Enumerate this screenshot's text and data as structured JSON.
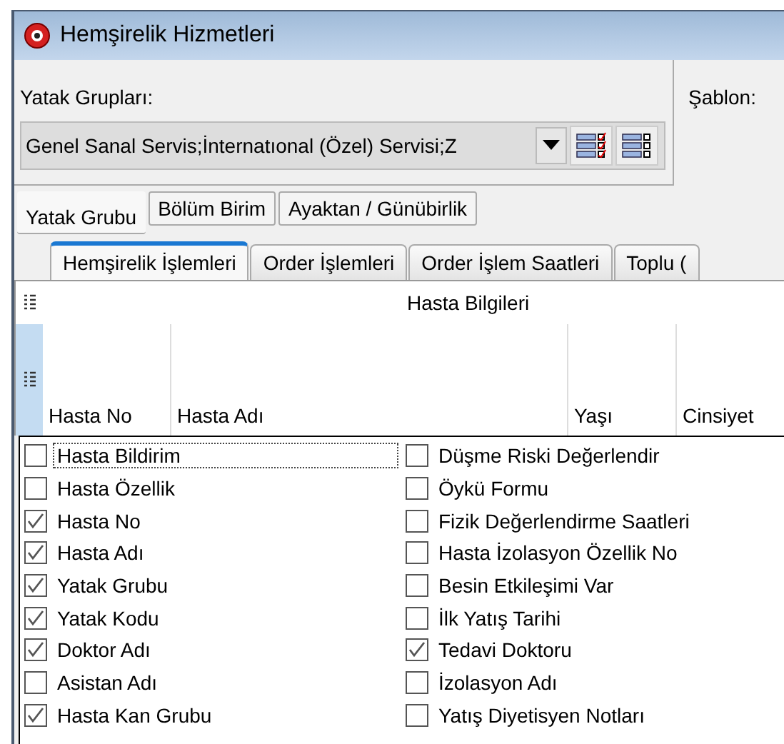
{
  "window": {
    "title": "Hemşirelik Hizmetleri"
  },
  "bed_groups": {
    "label": "Yatak Grupları:",
    "value": "Genel Sanal Servis;İnternatıonal (Özel) Servisi;Z"
  },
  "template": {
    "label": "Şablon:"
  },
  "group_tabs": [
    {
      "label": "Yatak Grubu",
      "selected": true
    },
    {
      "label": "Bölüm Birim",
      "selected": false
    },
    {
      "label": "Ayaktan / Günübirlik",
      "selected": false
    }
  ],
  "tabs": [
    {
      "label": "Hemşirelik İşlemleri",
      "selected": true
    },
    {
      "label": "Order İşlemleri",
      "selected": false
    },
    {
      "label": "Order İşlem Saatleri",
      "selected": false
    },
    {
      "label": "Toplu (",
      "selected": false
    }
  ],
  "grid": {
    "band": "Hasta Bilgileri",
    "columns": [
      "Hasta No",
      "Hasta Adı",
      "Yaşı",
      "Cinsiyet"
    ]
  },
  "column_chooser": {
    "columns": [
      [
        {
          "label": "Hasta Bildirim",
          "checked": false,
          "focused": true
        },
        {
          "label": "Hasta Özellik",
          "checked": false,
          "focused": false
        },
        {
          "label": "Hasta No",
          "checked": true,
          "focused": false
        },
        {
          "label": "Hasta Adı",
          "checked": true,
          "focused": false
        },
        {
          "label": "Yatak Grubu",
          "checked": true,
          "focused": false
        },
        {
          "label": "Yatak Kodu",
          "checked": true,
          "focused": false
        },
        {
          "label": "Doktor Adı",
          "checked": true,
          "focused": false
        },
        {
          "label": "Asistan Adı",
          "checked": false,
          "focused": false
        },
        {
          "label": "Hasta Kan Grubu",
          "checked": true,
          "focused": false
        }
      ],
      [
        {
          "label": "Düşme Riski Değerlendir",
          "checked": false,
          "focused": false
        },
        {
          "label": "Öykü Formu",
          "checked": false,
          "focused": false
        },
        {
          "label": "Fizik Değerlendirme Saatleri",
          "checked": false,
          "focused": false
        },
        {
          "label": "Hasta İzolasyon Özellik No",
          "checked": false,
          "focused": false
        },
        {
          "label": "Besin Etkileşimi Var",
          "checked": false,
          "focused": false
        },
        {
          "label": "İlk Yatış Tarihi",
          "checked": false,
          "focused": false
        },
        {
          "label": "Tedavi Doktoru",
          "checked": true,
          "focused": false
        },
        {
          "label": "İzolasyon Adı",
          "checked": false,
          "focused": false
        },
        {
          "label": "Yatış Diyetisyen Notları",
          "checked": false,
          "focused": false
        }
      ]
    ]
  }
}
